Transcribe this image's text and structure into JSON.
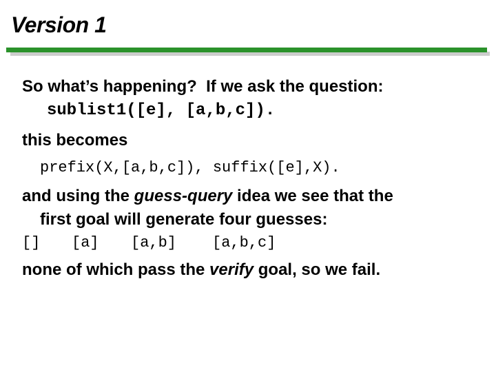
{
  "slide": {
    "title": "Version 1",
    "accent_color": "#2b922b",
    "shadow_color": "#cccccc"
  },
  "body": {
    "line1": "So what’s happening?  If we ask the question:",
    "query": "sublist1([e], [a,b,c]).",
    "line3": "this becomes",
    "becomes_code": "prefix(X,[a,b,c]), suffix([e],X).",
    "line5_pre": "and using the ",
    "line5_em": "guess-query",
    "line5_post": " idea we see that the",
    "line6": "first goal will generate four guesses:",
    "guesses": [
      "[]",
      "[a]",
      "[a,b]",
      "[a,b,c]"
    ],
    "line8_pre": "none of which pass the ",
    "line8_em": "verify",
    "line8_post": " goal, so we fail."
  }
}
